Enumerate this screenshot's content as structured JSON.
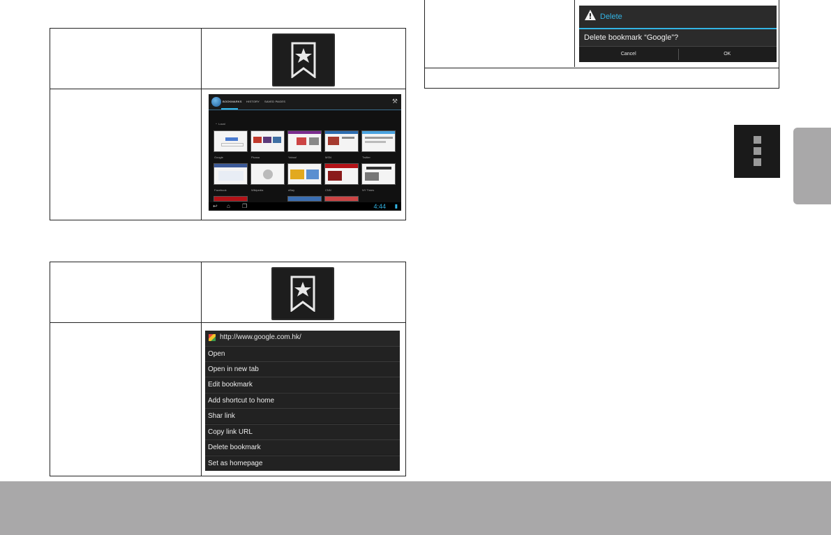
{
  "browser_screenshot": {
    "tabs": [
      "BOOKMARKS",
      "HISTORY",
      "SAVED PAGES"
    ],
    "folder_label": "Local",
    "bookmarks": [
      {
        "caption": "Google",
        "color": "#ffffff"
      },
      {
        "caption": "Picasa",
        "color": "#c0392b"
      },
      {
        "caption": "Yahoo!",
        "color": "#7b2c8f"
      },
      {
        "caption": "MSN",
        "color": "#2c6cb0"
      },
      {
        "caption": "Twitter",
        "color": "#4aa3df"
      },
      {
        "caption": "Facebook",
        "color": "#3b5998"
      },
      {
        "caption": "Wikipedia",
        "color": "#dddddd"
      },
      {
        "caption": "eBay",
        "color": "#e2a91f"
      },
      {
        "caption": "CNN",
        "color": "#b31217"
      },
      {
        "caption": "NY Times",
        "color": "#555555"
      }
    ],
    "clock": "4:44"
  },
  "context_menu": {
    "url": "http://www.google.com.hk/",
    "items": [
      "Open",
      "Open in new tab",
      "Edit bookmark",
      "Add shortcut to home",
      "Shar link",
      "Copy link URL",
      "Delete bookmark",
      "Set as homepage"
    ]
  },
  "delete_dialog": {
    "title": "Delete",
    "message": "Delete bookmark “Google”?",
    "cancel": "Cancel",
    "ok": "OK"
  },
  "icons": {
    "bookmark": "bookmark-star-icon",
    "menu": "overflow-menu-icon",
    "warning": "warning-icon"
  },
  "colors": {
    "accent": "#33b5e5",
    "footer": "#a9a8a9",
    "dark_panel": "#1d1d1d"
  }
}
